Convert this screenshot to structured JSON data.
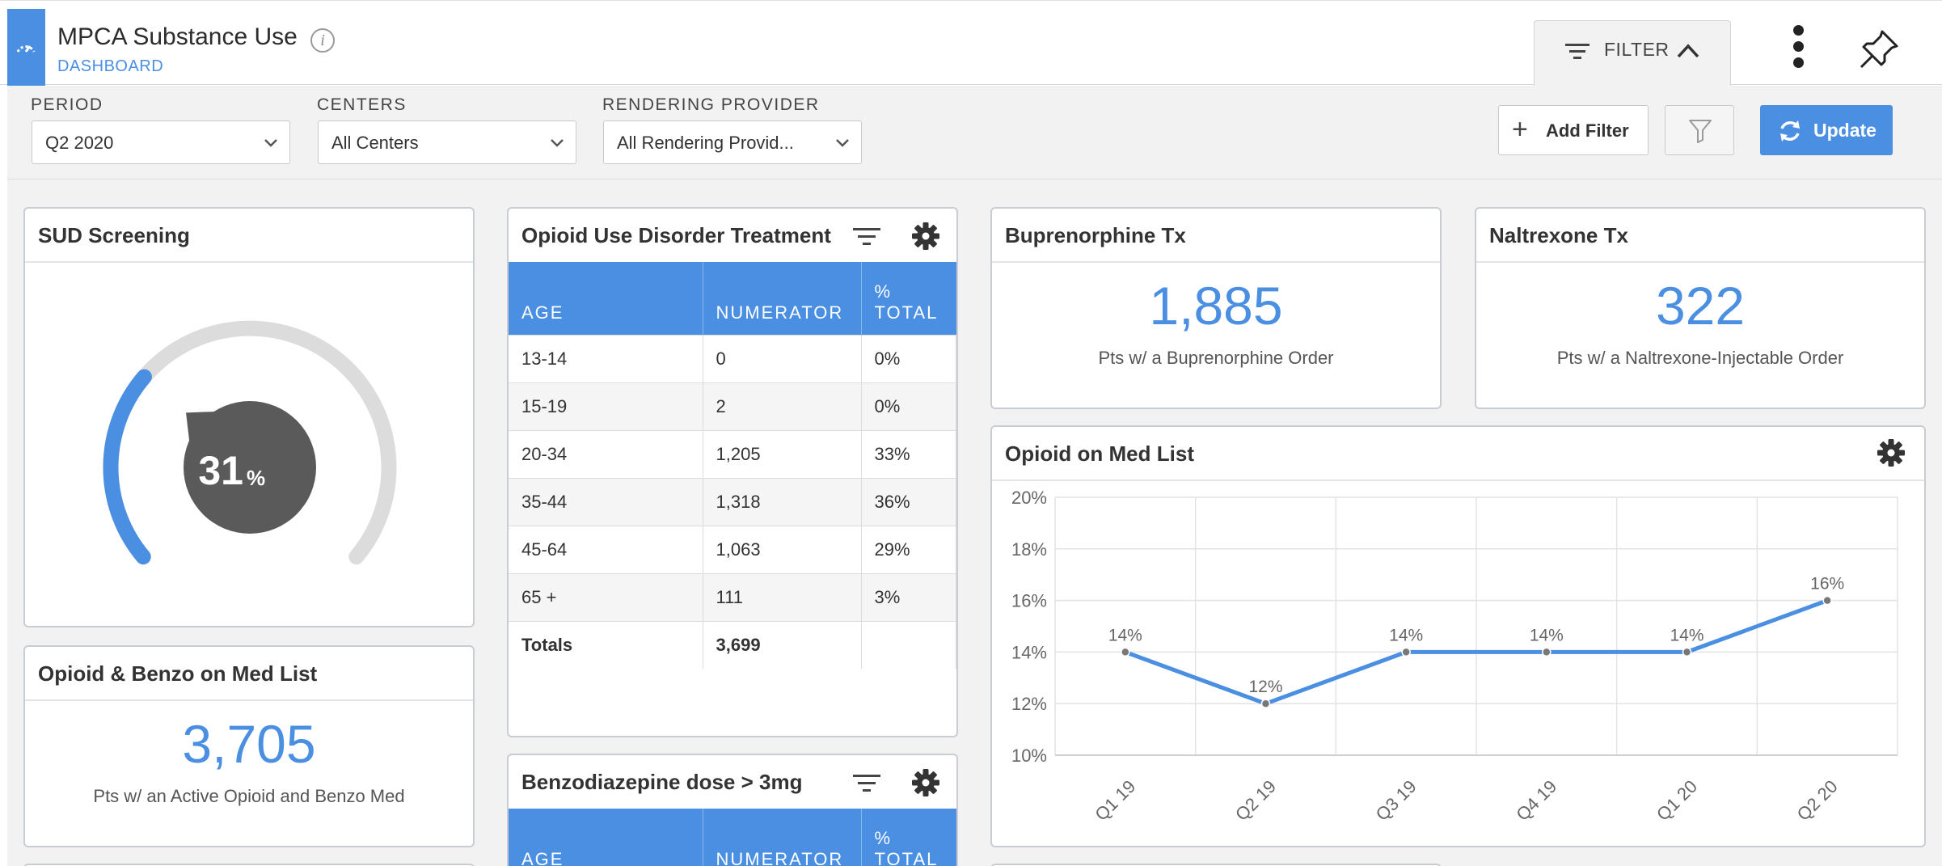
{
  "header": {
    "title": "MPCA Substance Use",
    "subtitle": "DASHBOARD",
    "info_icon": "info-icon",
    "filter_tab_label": "FILTER",
    "menu_icon": "kebab-menu-icon",
    "pin_icon": "pin-icon"
  },
  "filters": {
    "period": {
      "label": "PERIOD",
      "value": "Q2 2020"
    },
    "centers": {
      "label": "CENTERS",
      "value": "All Centers"
    },
    "provider": {
      "label": "RENDERING PROVIDER",
      "value": "All Rendering Provid..."
    },
    "add_filter_label": "Add Filter",
    "update_label": "Update"
  },
  "colors": {
    "accent": "#4a8fe2",
    "gauge_track": "#dcdcdc",
    "gauge_center": "#5a5a5a"
  },
  "sud_screening": {
    "title": "SUD Screening",
    "percent_value": 31,
    "percent_number": "31",
    "percent_sign": "%"
  },
  "opioid_benzo": {
    "title": "Opioid & Benzo on Med List",
    "value": "3,705",
    "caption": "Pts w/ an Active Opioid and Benzo Med"
  },
  "oud_treatment": {
    "title": "Opioid Use Disorder Treatment",
    "columns": [
      "AGE",
      "NUMERATOR",
      "%",
      "TOTAL"
    ],
    "rows": [
      [
        "13-14",
        "0",
        "0%"
      ],
      [
        "15-19",
        "2",
        "0%"
      ],
      [
        "20-34",
        "1,205",
        "33%"
      ],
      [
        "35-44",
        "1,318",
        "36%"
      ],
      [
        "45-64",
        "1,063",
        "29%"
      ],
      [
        "65 +",
        "111",
        "3%"
      ]
    ],
    "totals": [
      "Totals",
      "3,699",
      ""
    ]
  },
  "benzo_dose": {
    "title": "Benzodiazepine dose > 3mg",
    "columns": [
      "AGE",
      "NUMERATOR",
      "%",
      "TOTAL"
    ]
  },
  "buprenorphine": {
    "title": "Buprenorphine Tx",
    "value": "1,885",
    "caption": "Pts w/ a Buprenorphine Order"
  },
  "naltrexone": {
    "title": "Naltrexone Tx",
    "value": "322",
    "caption": "Pts w/ a Naltrexone-Injectable Order"
  },
  "opioid_med_list": {
    "title": "Opioid on Med List"
  },
  "chart_data": {
    "type": "line",
    "title": "Opioid on Med List",
    "x": [
      "Q1 19",
      "Q2 19",
      "Q3 19",
      "Q4 19",
      "Q1 20",
      "Q2 20"
    ],
    "series": [
      {
        "values": [
          14,
          12,
          14,
          14,
          14,
          16
        ]
      }
    ],
    "data_labels": [
      "14%",
      "12%",
      "14%",
      "14%",
      "14%",
      "16%"
    ],
    "y_ticks": [
      "20%",
      "18%",
      "16%",
      "14%",
      "12%",
      "10%"
    ],
    "ylim": [
      10,
      20
    ],
    "grid": true,
    "color": "#4a8fe2"
  }
}
